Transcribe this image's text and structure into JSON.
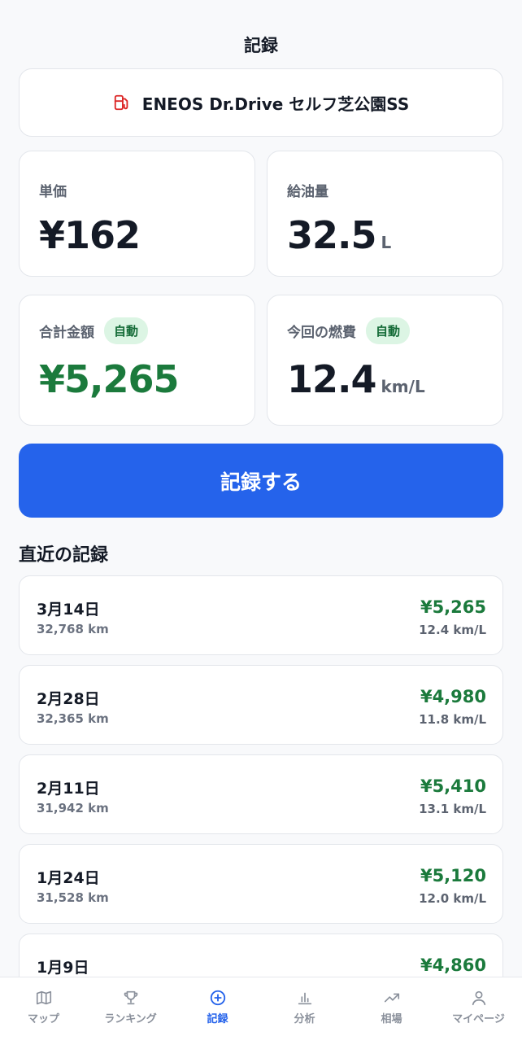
{
  "header": {
    "title": "記録"
  },
  "station": {
    "name": "ENEOS Dr.Drive セルフ芝公園SS",
    "icon": "fuel-pump-icon",
    "icon_color": "#dc2626"
  },
  "stats": {
    "unit_price": {
      "label": "単価",
      "value": "¥162"
    },
    "amount": {
      "label": "給油量",
      "value": "32.5",
      "unit": "L"
    },
    "total": {
      "label": "合計金額",
      "badge": "自動",
      "value": "¥5,265"
    },
    "economy": {
      "label": "今回の燃費",
      "badge": "自動",
      "value": "12.4",
      "unit": "km/L"
    }
  },
  "record_button": {
    "label": "記録する"
  },
  "recent": {
    "title": "直近の記録",
    "items": [
      {
        "date": "3月14日",
        "odometer": "32,768 km",
        "cost": "¥5,265",
        "economy": "12.4 km/L"
      },
      {
        "date": "2月28日",
        "odometer": "32,365 km",
        "cost": "¥4,980",
        "economy": "11.8 km/L"
      },
      {
        "date": "2月11日",
        "odometer": "31,942 km",
        "cost": "¥5,410",
        "economy": "13.1 km/L"
      },
      {
        "date": "1月24日",
        "odometer": "31,528 km",
        "cost": "¥5,120",
        "economy": "12.0 km/L"
      },
      {
        "date": "1月9日",
        "odometer": "",
        "cost": "¥4,860",
        "economy": ""
      }
    ]
  },
  "tabs": [
    {
      "label": "マップ",
      "icon": "map-icon",
      "active": false
    },
    {
      "label": "ランキング",
      "icon": "trophy-icon",
      "active": false
    },
    {
      "label": "記録",
      "icon": "plus-circle-icon",
      "active": true
    },
    {
      "label": "分析",
      "icon": "bar-chart-icon",
      "active": false
    },
    {
      "label": "相場",
      "icon": "trending-up-icon",
      "active": false
    },
    {
      "label": "マイページ",
      "icon": "user-icon",
      "active": false
    }
  ],
  "colors": {
    "accent": "#2563eb",
    "positive": "#1b7a3c",
    "badge_bg": "#dcf5e4"
  }
}
